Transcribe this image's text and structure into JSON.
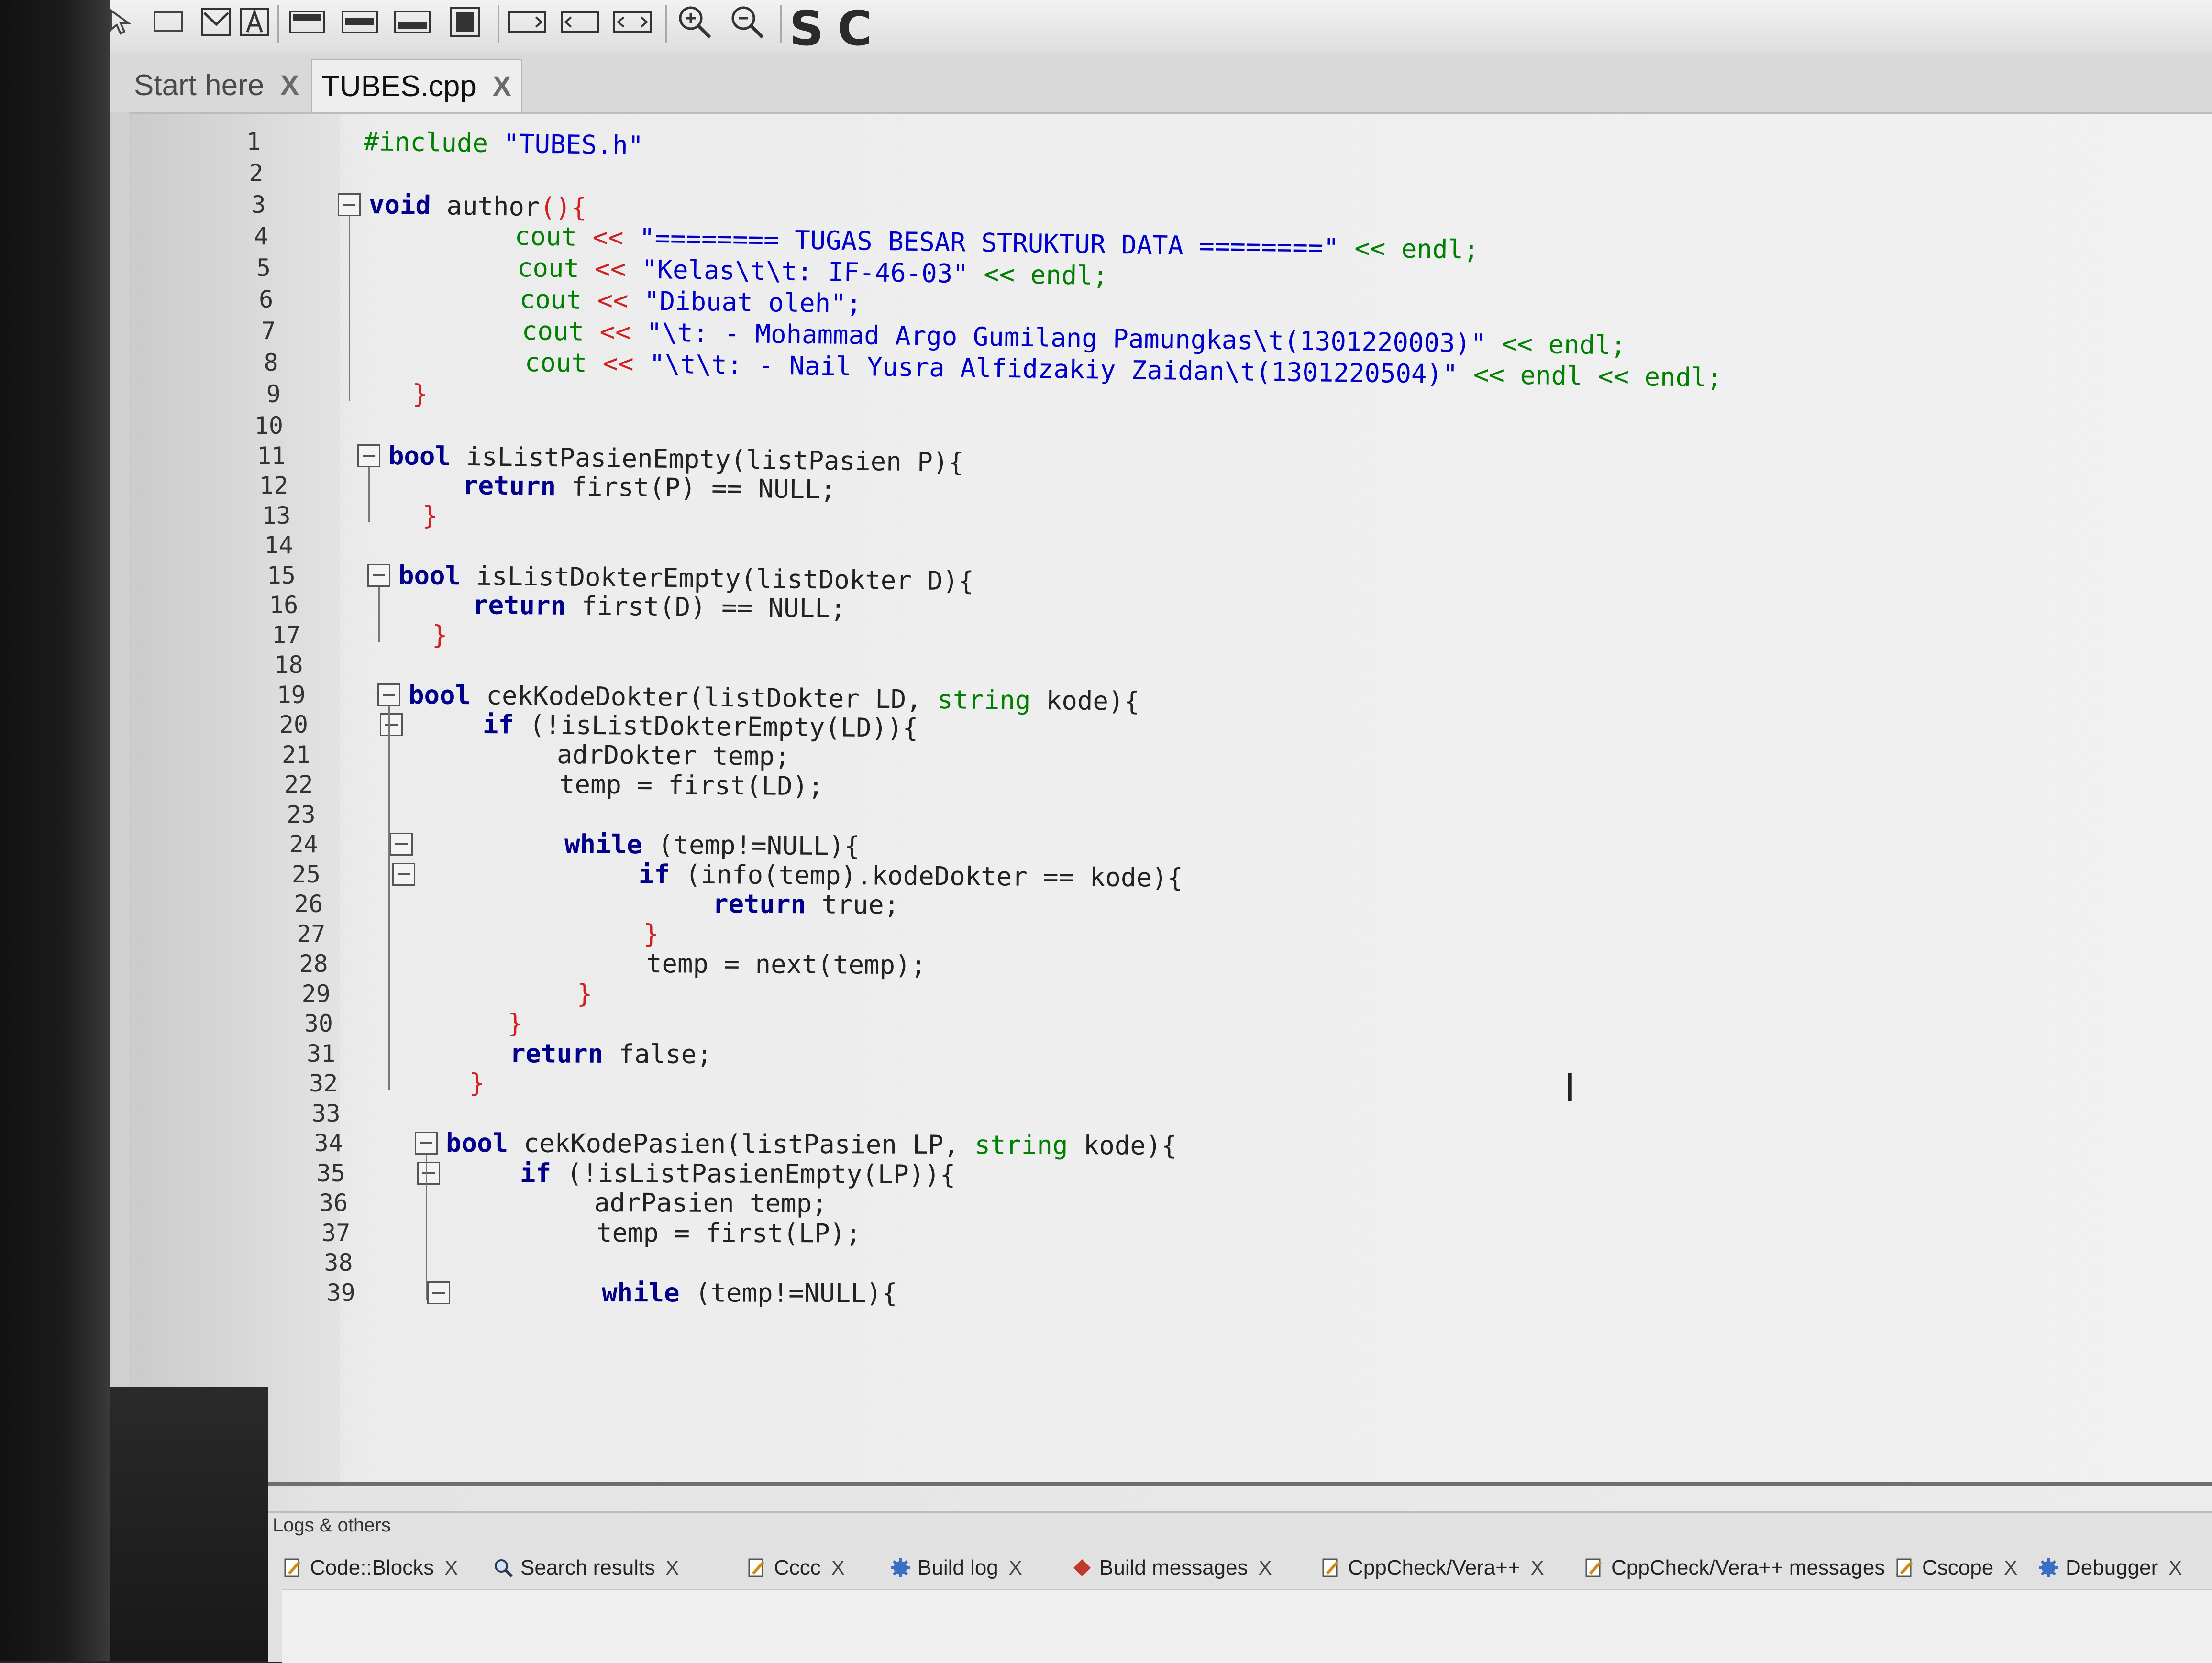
{
  "tabs": [
    {
      "label": "Start here",
      "close": "X"
    },
    {
      "label": "TUBES.cpp",
      "close": "X"
    }
  ],
  "toolbar": {
    "letter_s": "S",
    "letter_c": "C"
  },
  "line_numbers": [
    "1",
    "2",
    "3",
    "4",
    "5",
    "6",
    "7",
    "8",
    "9",
    "10",
    "11",
    "12",
    "13",
    "14",
    "15",
    "16",
    "17",
    "18",
    "19",
    "20",
    "21",
    "22",
    "23",
    "24",
    "25",
    "26",
    "27",
    "28",
    "29",
    "30",
    "31",
    "32",
    "33",
    "34",
    "35",
    "36",
    "37",
    "38",
    "39"
  ],
  "code": {
    "l1_inc": "#include",
    "l1_file": "\"TUBES.h\"",
    "l3_kw": "void",
    "l3_rest": "author",
    "l3_br": "(){",
    "l4_cout": "cout",
    "l4_op": "<<",
    "l4_str": "\"======== TUGAS BESAR STRUKTUR DATA ========\"",
    "l4_end": "<< endl;",
    "l5_cout": "cout",
    "l5_op": "<<",
    "l5_str": "\"Kelas\\t\\t: IF-46-03\"",
    "l5_end": "<< endl;",
    "l6_cout": "cout",
    "l6_op": "<<",
    "l6_str": "\"Dibuat oleh\";",
    "l7_cout": "cout",
    "l7_op": "<<",
    "l7_str": "\"\\t: - Mohammad Argo Gumilang Pamungkas\\t(1301220003)\"",
    "l7_end": "<< endl;",
    "l8_cout": "cout",
    "l8_op": "<<",
    "l8_str": "\"\\t\\t: - Nail Yusra Alfidzakiy Zaidan\\t(1301220504)\"",
    "l8_end": "<< endl << endl;",
    "l9": "}",
    "l11_kw": "bool",
    "l11_rest": "isListPasienEmpty(listPasien P){",
    "l12_kw": "return",
    "l12_rest": "first(P) == NULL;",
    "l13": "}",
    "l15_kw": "bool",
    "l15_rest": "isListDokterEmpty(listDokter D){",
    "l16_kw": "return",
    "l16_rest": "first(D) == NULL;",
    "l17": "}",
    "l19_kw": "bool",
    "l19_a": "cekKodeDokter(listDokter LD,",
    "l19_type": "string",
    "l19_b": "kode){",
    "l20_kw": "if",
    "l20_rest": "(!isListDokterEmpty(LD)){",
    "l21": "adrDokter temp;",
    "l22": "temp = first(LD);",
    "l24_kw": "while",
    "l24_rest": "(temp!=NULL){",
    "l25_kw": "if",
    "l25_rest": "(info(temp).kodeDokter == kode){",
    "l26_kw": "return",
    "l26_rest": "true;",
    "l27": "}",
    "l28": "temp = next(temp);",
    "l29": "}",
    "l30": "}",
    "l31_kw": "return",
    "l31_rest": "false;",
    "l32": "}",
    "l34_kw": "bool",
    "l34_a": "cekKodePasien(listPasien LP,",
    "l34_type": "string",
    "l34_b": "kode){",
    "l35_kw": "if",
    "l35_rest": "(!isListPasienEmpty(LP)){",
    "l36": "adrPasien temp;",
    "l37": "temp = first(LP);",
    "l39_kw": "while",
    "l39_rest": "(temp!=NULL){"
  },
  "logs": {
    "title": "Logs & others",
    "tabs": [
      {
        "label": "Code::Blocks",
        "icon": "pencil-doc-icon",
        "close": "X"
      },
      {
        "label": "Search results",
        "icon": "magnifier-icon",
        "close": "X"
      },
      {
        "label": "Cccc",
        "icon": "pencil-doc-icon",
        "close": "X"
      },
      {
        "label": "Build log",
        "icon": "gear-icon",
        "close": "X"
      },
      {
        "label": "Build messages",
        "icon": "diamond-icon",
        "close": "X"
      },
      {
        "label": "CppCheck/Vera++",
        "icon": "pencil-doc-icon",
        "close": "X"
      },
      {
        "label": "CppCheck/Vera++ messages",
        "icon": "pencil-doc-icon",
        "close": "X"
      },
      {
        "label": "Cscope",
        "icon": "pencil-doc-icon",
        "close": "X"
      },
      {
        "label": "Debugger",
        "icon": "gear-icon",
        "close": "X"
      }
    ]
  },
  "colors": {
    "keyword": "#00008b",
    "string": "#0000cc",
    "preprocessor": "#008000",
    "brace": "#d02020"
  }
}
